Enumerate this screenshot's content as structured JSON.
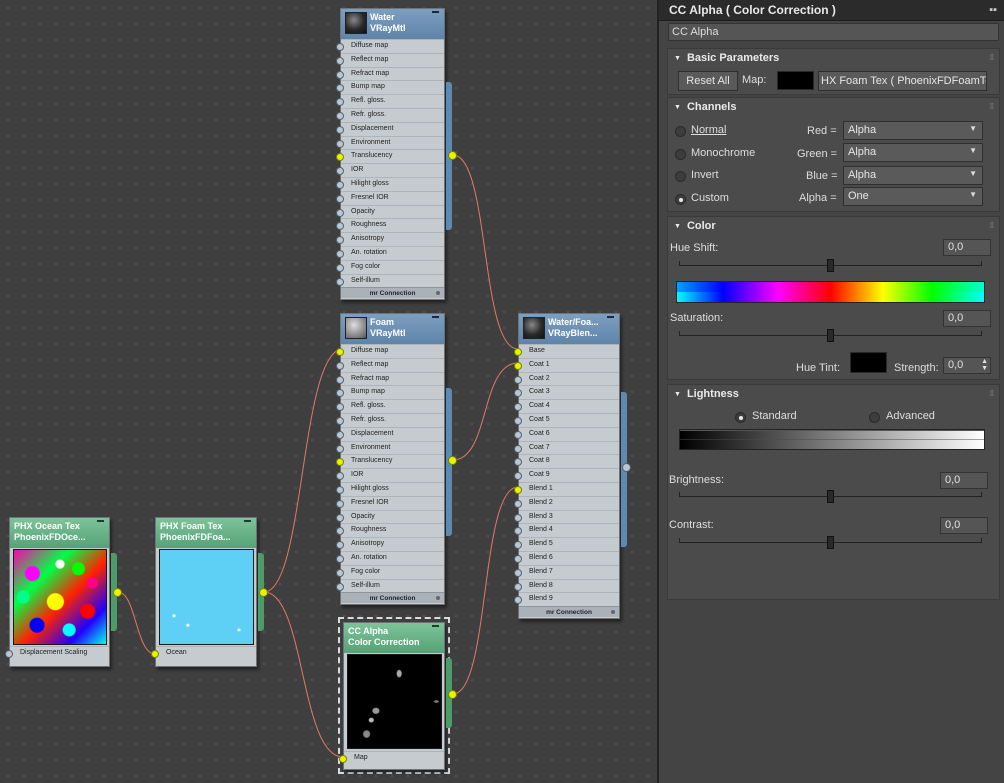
{
  "nodes": {
    "water": {
      "title1": "Water",
      "title2": "VRayMtl",
      "slots": [
        "Diffuse map",
        "Reflect map",
        "Refract map",
        "Bump map",
        "Refl. gloss.",
        "Refr. gloss.",
        "Displacement",
        "Environment",
        "Translucency",
        "IOR",
        "Hilight gloss",
        "Fresnel IOR",
        "Opacity",
        "Roughness",
        "Anisotropy",
        "An. rotation",
        "Fog color",
        "Self-illum"
      ],
      "footer": "mr Connection"
    },
    "foam": {
      "title1": "Foam",
      "title2": "VRayMtl",
      "slots": [
        "Diffuse map",
        "Reflect map",
        "Refract map",
        "Bump map",
        "Refl. gloss.",
        "Refr. gloss.",
        "Displacement",
        "Environment",
        "Translucency",
        "IOR",
        "Hilight gloss",
        "Fresnel IOR",
        "Opacity",
        "Roughness",
        "Anisotropy",
        "An. rotation",
        "Fog color",
        "Self-illum"
      ],
      "footer": "mr Connection"
    },
    "blend": {
      "title1": "Water/Foa...",
      "title2": "VRayBlen...",
      "slots": [
        "Base",
        "Coat 1",
        "Coat 2",
        "Coat 3",
        "Coat 4",
        "Coat 5",
        "Coat 6",
        "Coat 7",
        "Coat 8",
        "Coat 9",
        "Blend 1",
        "Blend 2",
        "Blend 3",
        "Blend 4",
        "Blend 5",
        "Blend 6",
        "Blend 7",
        "Blend 8",
        "Blend 9"
      ],
      "footer": "mr Connection"
    },
    "ocean": {
      "title1": "PHX Ocean Tex",
      "title2": "PhoenixFDOce...",
      "slots": [
        "Displacement Scaling"
      ]
    },
    "foamtex": {
      "title1": "PHX Foam Tex",
      "title2": "PhoenixFDFoa...",
      "slots": [
        "Ocean"
      ]
    },
    "ccalpha": {
      "title1": "CC Alpha",
      "title2": "Color Correction",
      "slots": [
        "Map"
      ]
    }
  },
  "panel": {
    "title": "CC Alpha  ( Color Correction )",
    "name_value": "CC Alpha",
    "basic": {
      "header": "Basic Parameters",
      "reset_label": "Reset All",
      "map_label": "Map:",
      "map_value": "HX Foam Tex  ( PhoenixFDFoamTex"
    },
    "channels": {
      "header": "Channels",
      "modes": [
        "Normal",
        "Monochrome",
        "Invert",
        "Custom"
      ],
      "selected": "Custom",
      "rows": [
        {
          "label": "Red =",
          "value": "Alpha"
        },
        {
          "label": "Green =",
          "value": "Alpha"
        },
        {
          "label": "Blue =",
          "value": "Alpha"
        },
        {
          "label": "Alpha =",
          "value": "One"
        }
      ]
    },
    "color": {
      "header": "Color",
      "hue_shift_label": "Hue Shift:",
      "hue_shift_value": "0,0",
      "saturation_label": "Saturation:",
      "saturation_value": "0,0",
      "hue_tint_label": "Hue Tint:",
      "strength_label": "Strength:",
      "strength_value": "0,0"
    },
    "lightness": {
      "header": "Lightness",
      "modes": [
        "Standard",
        "Advanced"
      ],
      "selected": "Standard",
      "brightness_label": "Brightness:",
      "brightness_value": "0,0",
      "contrast_label": "Contrast:",
      "contrast_value": "0,0"
    }
  },
  "colors": {
    "material_header": "#6a8fb5",
    "map_header": "#62b083",
    "socket_connected": "#e6f400",
    "wire": "#e07a64"
  }
}
